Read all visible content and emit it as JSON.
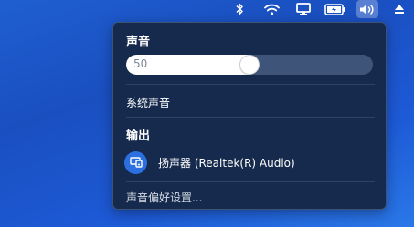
{
  "menubar": {
    "icons": [
      "bluetooth-icon",
      "wifi-icon",
      "display-icon",
      "battery-charging-icon",
      "volume-icon",
      "eject-icon"
    ]
  },
  "sound_menu": {
    "title": "声音",
    "volume": {
      "value_text": "50",
      "level": 0.5
    },
    "system_sounds_label": "系统声音",
    "output_title": "输出",
    "output_device": {
      "icon": "speaker-display-icon",
      "label": "扬声器 (Realtek(R) Audio)"
    },
    "preferences_label": "声音偏好设置..."
  },
  "colors": {
    "desktop": "#1d55c8",
    "popup_bg": "#152a4c",
    "accent": "#2b6fe0"
  }
}
